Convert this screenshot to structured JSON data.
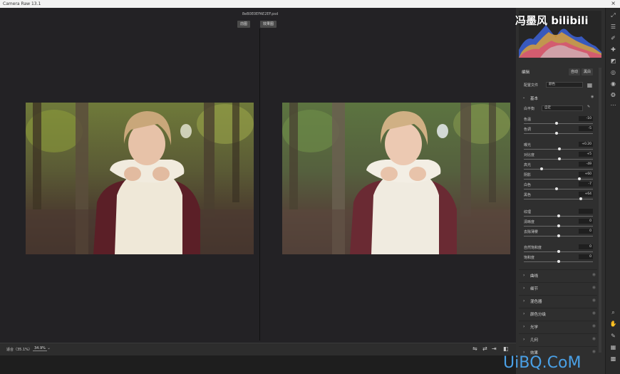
{
  "window": {
    "title": "Camera Raw 13.1",
    "close": "×"
  },
  "document": {
    "filename": "8eB0E0EFAE2EF.psd"
  },
  "view": {
    "before": "前图",
    "after": "效果图"
  },
  "bottom": {
    "zoom_label": "适合（35.1%）",
    "zoom_value": "34.9%",
    "zoom_caret": "⌄"
  },
  "panel": {
    "edit_title": "编辑",
    "auto": "自动",
    "bw": "黑白",
    "profile_label": "配置文件",
    "profile_value": "颜色",
    "basic_section": "基本",
    "wb_label": "白平衡",
    "wb_value": "自定",
    "rows": [
      {
        "label": "色温",
        "value": "-10",
        "pos": 0.47
      },
      {
        "label": "色调",
        "value": "-5",
        "pos": 0.47
      },
      {
        "label": "曝光",
        "value": "+0.20",
        "pos": 0.52
      },
      {
        "label": "对比度",
        "value": "+5",
        "pos": 0.52
      },
      {
        "label": "高光",
        "value": "-49",
        "pos": 0.26
      },
      {
        "label": "阴影",
        "value": "+60",
        "pos": 0.8
      },
      {
        "label": "白色",
        "value": "-7",
        "pos": 0.47
      },
      {
        "label": "黑色",
        "value": "+64",
        "pos": 0.82
      },
      {
        "label": "纹理",
        "value": "",
        "pos": 0.5
      },
      {
        "label": "清晰度",
        "value": "0",
        "pos": 0.5
      },
      {
        "label": "去除薄雾",
        "value": "0",
        "pos": 0.5
      },
      {
        "label": "自然饱和度",
        "value": "0",
        "pos": 0.5
      },
      {
        "label": "饱和度",
        "value": "0",
        "pos": 0.5
      }
    ],
    "sections": [
      "曲线",
      "细节",
      "混色器",
      "颜色分级",
      "光学",
      "几何",
      "效果"
    ]
  },
  "watermarks": {
    "top": "冯墨风 bilibili",
    "bottom": "UiBQ.CoM"
  },
  "colors": {
    "accent": "#4aa0e6",
    "panel_bg": "#2f2f2f",
    "canvas_bg": "#232225"
  }
}
